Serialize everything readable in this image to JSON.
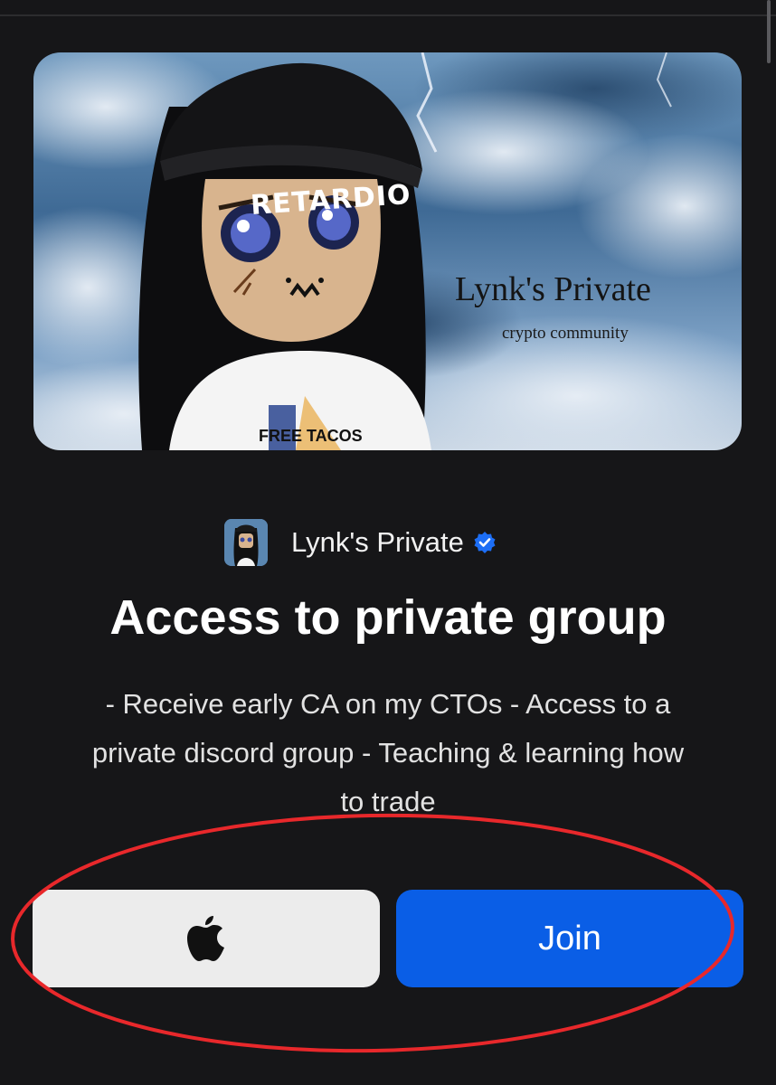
{
  "banner": {
    "title": "Lynk's Private",
    "subtitle": "crypto community",
    "hat_text": "RETARDIO",
    "shirt_text": "FREE TACOS"
  },
  "creator": {
    "name": "Lynk's Private",
    "avatar_icon": "creator-avatar",
    "verified_icon": "verified-badge-icon",
    "verified_color": "#1d6ef5"
  },
  "product": {
    "title": "Access to private group",
    "description": "- Receive early CA on my CTOs - Access to a private discord group - Teaching & learning how to trade"
  },
  "buttons": {
    "apple_pay_icon": "apple-logo-icon",
    "join_label": "Join",
    "join_color": "#0a5ee6"
  },
  "annotation": {
    "color": "#e8282b",
    "shape": "ellipse around payment buttons"
  }
}
